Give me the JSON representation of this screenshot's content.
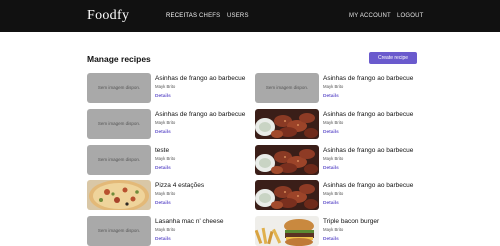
{
  "header": {
    "brand": "Foodfy",
    "nav_left": [
      "RECEITAS",
      "CHEFS",
      "USERS"
    ],
    "nav_right": [
      "MY ACCOUNT",
      "LOGOUT"
    ]
  },
  "main": {
    "title": "Manage recipes",
    "create_label": "Create recipe"
  },
  "recipes": [
    {
      "title": "Asinhas de frango ao barbecue",
      "author": "Mayk Brito",
      "details": "Details",
      "image": "placeholder",
      "placeholder_text": "Sem imagem dispon."
    },
    {
      "title": "Asinhas de frango ao barbecue",
      "author": "Mayk Brito",
      "details": "Details",
      "image": "placeholder",
      "placeholder_text": "Sem imagem dispon."
    },
    {
      "title": "Asinhas de frango ao barbecue",
      "author": "Mayk Brito",
      "details": "Details",
      "image": "placeholder",
      "placeholder_text": "Sem imagem dispon."
    },
    {
      "title": "Asinhas de frango ao barbecue",
      "author": "Mayk Brito",
      "details": "Details",
      "image": "wings-photo"
    },
    {
      "title": "teste",
      "author": "Mayk Brito",
      "details": "Details",
      "image": "placeholder",
      "placeholder_text": "Sem imagem dispon."
    },
    {
      "title": "Asinhas de frango ao barbecue",
      "author": "Mayk Brito",
      "details": "Details",
      "image": "wings-photo"
    },
    {
      "title": "Pizza 4 estações",
      "author": "Mayk Brito",
      "details": "Details",
      "image": "pizza-photo"
    },
    {
      "title": "Asinhas de frango ao barbecue",
      "author": "Mayk Brito",
      "details": "Details",
      "image": "wings-photo"
    },
    {
      "title": "Lasanha mac n' cheese",
      "author": "Mayk Brito",
      "details": "Details",
      "image": "placeholder",
      "placeholder_text": "Sem imagem dispon."
    },
    {
      "title": "Triple bacon burger",
      "author": "Mayk Brito",
      "details": "Details",
      "image": "burger-photo"
    }
  ],
  "colors": {
    "topbar": "#111111",
    "accent": "#6a5acd",
    "placeholder": "#a9a9a9"
  }
}
